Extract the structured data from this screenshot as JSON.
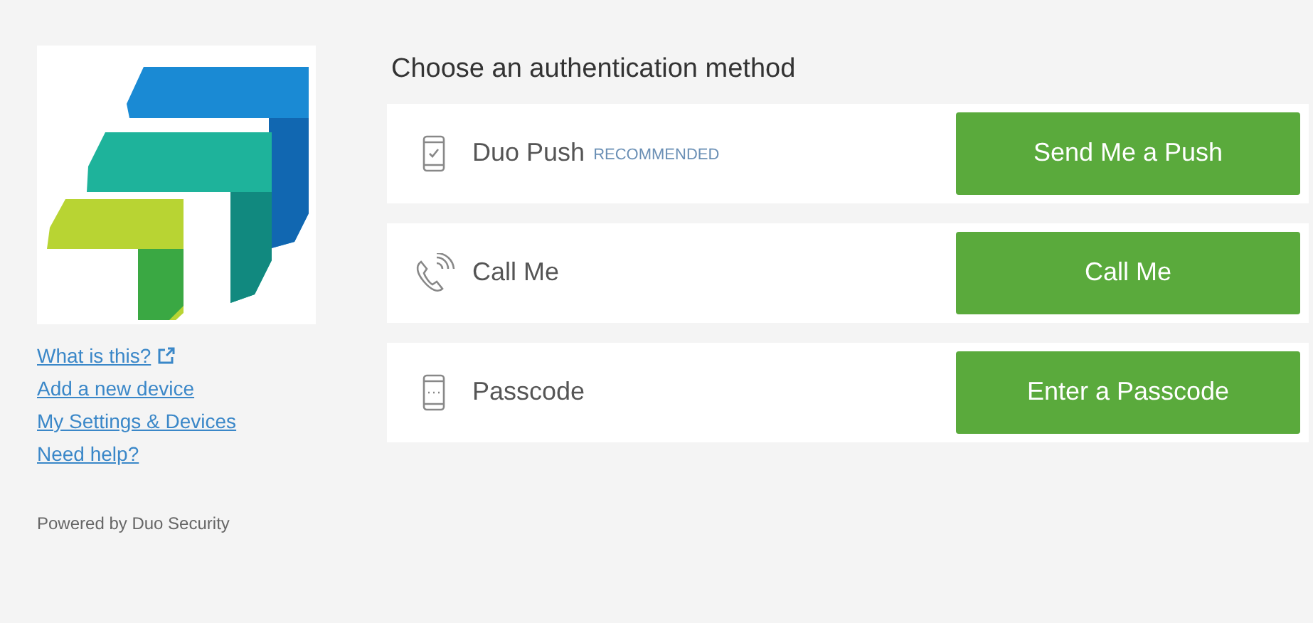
{
  "sidebar": {
    "links": [
      {
        "label": "What is this?",
        "external": true
      },
      {
        "label": "Add a new device",
        "external": false
      },
      {
        "label": "My Settings & Devices",
        "external": false
      },
      {
        "label": "Need help?",
        "external": false
      }
    ],
    "footer": "Powered by Duo Security"
  },
  "heading": "Choose an authentication method",
  "methods": [
    {
      "kind": "push",
      "label": "Duo Push",
      "badge": "RECOMMENDED",
      "button": "Send Me a Push"
    },
    {
      "kind": "call",
      "label": "Call Me",
      "button": "Call Me"
    },
    {
      "kind": "passcode",
      "label": "Passcode",
      "button": "Enter a Passcode"
    }
  ]
}
